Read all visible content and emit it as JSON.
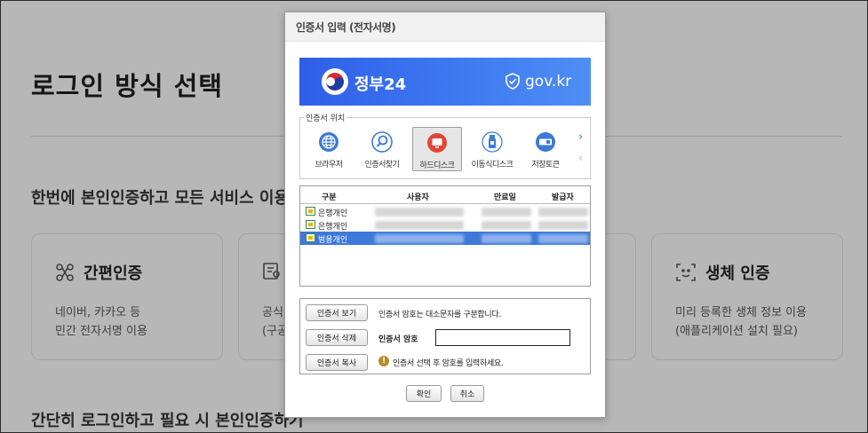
{
  "background": {
    "page_title": "로그인 방식 선택",
    "section_title": "한번에 본인인증하고 모든 서비스 이용",
    "section2_title": "간단히 로그인하고 필요 시 본인인증하기",
    "cards": [
      {
        "icon": "simple-auth-icon",
        "title": "간편인증",
        "desc1": "네이버, 카카오 등",
        "desc2": "민간 전자서명 이용"
      },
      {
        "icon": "certificate-icon",
        "title": "",
        "desc1": "공식",
        "desc2": "(구공"
      },
      {
        "icon": "biometric-icon",
        "title": "생체 인증",
        "desc1": "미리 등록한 생체 정보 이용",
        "desc2": "(애플리케이션 설치 필요)"
      }
    ]
  },
  "dialog": {
    "title": "인증서 입력 (전자서명)",
    "banner": {
      "name": "정부24",
      "url": "gov.kr",
      "color_start": "#2f5fe8",
      "color_end": "#4f8ef5"
    },
    "location": {
      "legend": "인증서 위치",
      "items": [
        {
          "label": "브라우저",
          "icon": "globe-icon",
          "selected": false
        },
        {
          "label": "인증서찾기",
          "icon": "magnifier-icon",
          "selected": false
        },
        {
          "label": "하드디스크",
          "icon": "harddisk-icon",
          "selected": true
        },
        {
          "label": "이동식디스크",
          "icon": "usb-icon",
          "selected": false
        },
        {
          "label": "저장토큰",
          "icon": "token-icon",
          "selected": false
        }
      ],
      "next_arrow": "›",
      "prev_arrow": "‹"
    },
    "table": {
      "headers": [
        "구분",
        "사용자",
        "만료일",
        "발급자"
      ],
      "rows": [
        {
          "type": "은행개인",
          "selected": false
        },
        {
          "type": "은행개인",
          "selected": false
        },
        {
          "type": "범용개인",
          "selected": true
        }
      ]
    },
    "actions": {
      "view_label": "인증서 보기",
      "delete_label": "인증서 삭제",
      "copy_label": "인증서 복사",
      "case_note": "인증서 암호는 대소문자를 구분합니다.",
      "password_label": "인증서 암호",
      "password_value": "",
      "warning_text": "인증서 선택 후 암호를 입력하세요."
    },
    "ok_label": "확인",
    "cancel_label": "취소"
  },
  "colors": {
    "selection": "#3e78d8",
    "accent_blue": "#3a7bd5",
    "warning": "#b88a2a"
  }
}
